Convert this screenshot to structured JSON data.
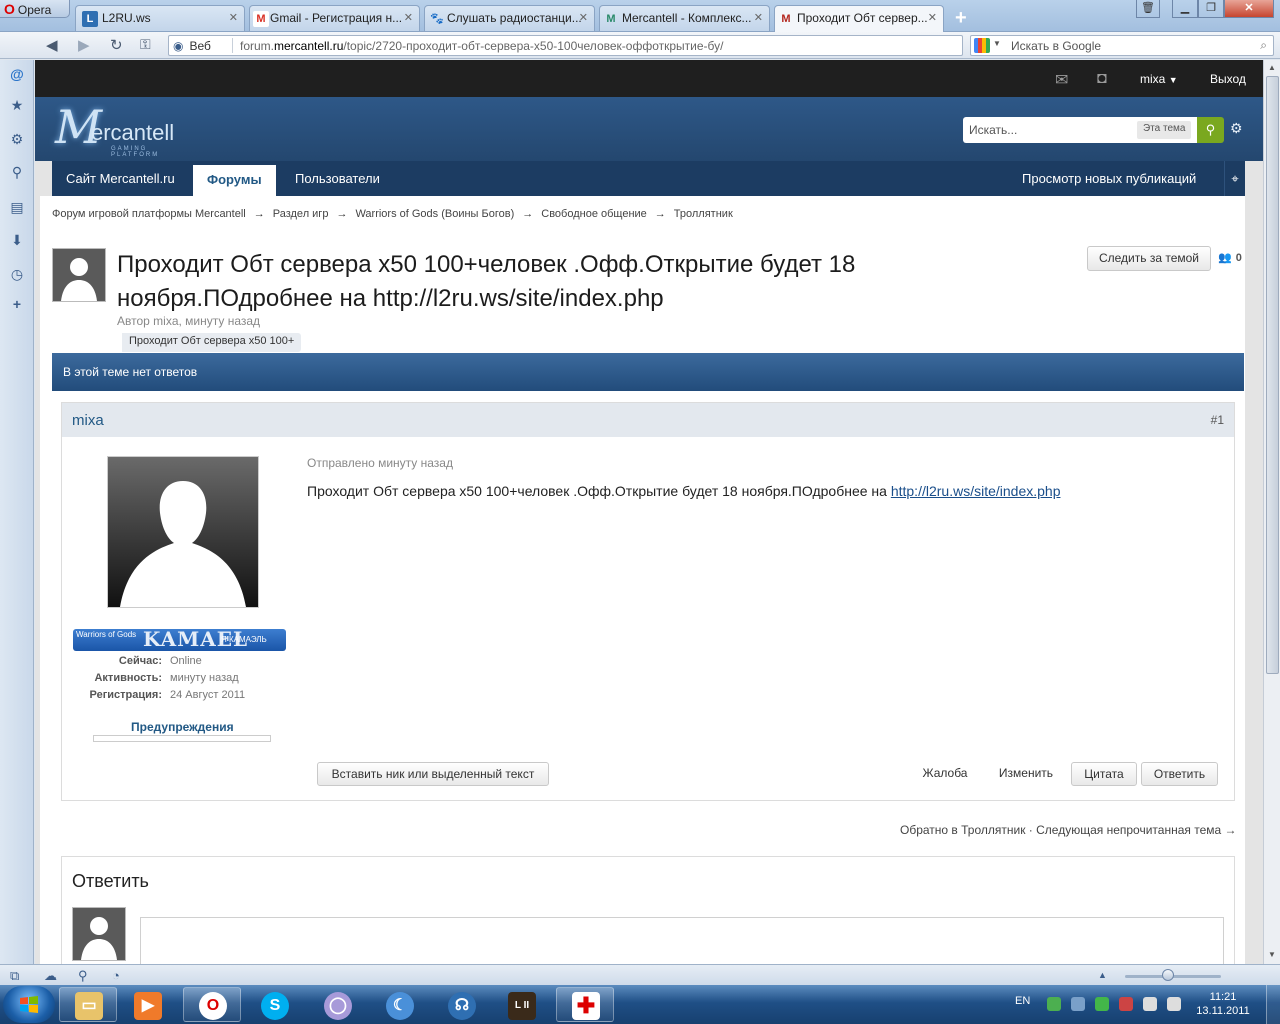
{
  "browser": {
    "menu_label": "Opera",
    "tabs": [
      {
        "title": "L2RU.ws",
        "icon": "l2ru-icon",
        "active": false
      },
      {
        "title": "Gmail - Регистрация н...",
        "icon": "gmail-icon",
        "active": false
      },
      {
        "title": "Слушать радиостанци...",
        "icon": "paw-icon",
        "active": false
      },
      {
        "title": "Mercantell - Комплекс...",
        "icon": "mercantell-icon",
        "active": false
      },
      {
        "title": "Проходит Обт сервер...",
        "icon": "mercantell-icon",
        "active": true
      }
    ],
    "address": {
      "scope_label": "Веб",
      "url_prefix": "forum.",
      "url_domain": "mercantell.ru",
      "url_path": "/topic/2720-проходит-обт-сервера-x50-100человек-оффоткрытие-бу/"
    },
    "search_placeholder": "Искать в Google"
  },
  "site": {
    "userbar": {
      "username": "mixa",
      "logout": "Выход"
    },
    "logo": {
      "letter": "M",
      "text": "ercantell",
      "sub": "GAMING PLATFORM"
    },
    "search": {
      "placeholder": "Искать...",
      "scope": "Эта тема"
    },
    "nav": {
      "tabs": [
        "Сайт Mercantell.ru",
        "Форумы",
        "Пользователи"
      ],
      "active_tab": "Форумы",
      "right_link": "Просмотр новых публикаций"
    },
    "breadcrumb": [
      "Форум игровой платформы Mercantell",
      "Раздел игр",
      "Warriors of Gods (Воины Богов)",
      "Свободное общение",
      "Троллятник"
    ]
  },
  "topic": {
    "title": "Проходит Обт сервера x50 100+человек .Офф.Открытие будет 18 ноября.ПОдробнее на http://l2ru.ws/site/index.php",
    "author_line": "Автор mixa, минуту назад",
    "tag": "Проходит Обт сервера x50 100+",
    "follow_button": "Следить за темой",
    "followers_count": "0",
    "no_replies_text": "В этой теме нет ответов"
  },
  "post": {
    "author": "mixa",
    "number": "#1",
    "badge": {
      "line1": "Warriors of Gods",
      "logo": "KAMAEL",
      "line2": "Я КАМАЭЛЬ"
    },
    "meta": [
      {
        "key": "Сейчас:",
        "value": "Online"
      },
      {
        "key": "Активность:",
        "value": "минуту назад"
      },
      {
        "key": "Регистрация:",
        "value": "24 Август 2011"
      }
    ],
    "warnings_label": "Предупреждения",
    "sent_label": "Отправлено минуту назад",
    "body_text": "Проходит Обт сервера x50 100+человек .Офф.Открытие будет 18 ноября.ПОдробнее на ",
    "body_link": "http://l2ru.ws/site/index.php",
    "buttons": {
      "insert_nick": "Вставить ник или выделенный текст",
      "report": "Жалоба",
      "edit": "Изменить",
      "quote": "Цитата",
      "reply": "Ответить"
    }
  },
  "bottom_nav": "Обратно в Троллятник · Следующая непрочитанная тема →",
  "reply_box": {
    "title": "Ответить"
  },
  "taskbar": {
    "lang": "EN",
    "time": "11:21",
    "date": "13.11.2011"
  }
}
